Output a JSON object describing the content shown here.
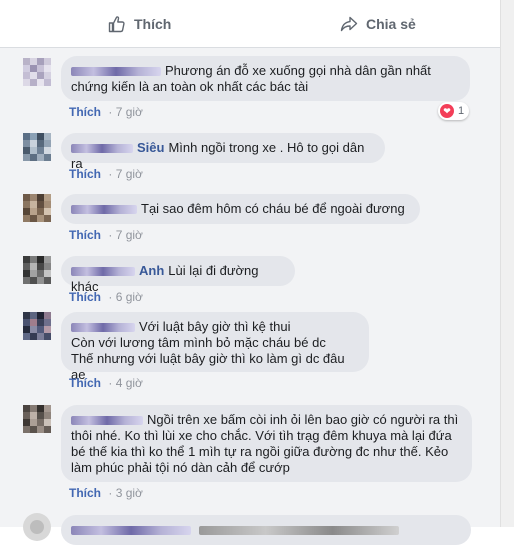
{
  "actions": {
    "like_label": "Thích",
    "share_label": "Chia sẻ"
  },
  "comments": [
    {
      "name": "",
      "text": "Phương án đỗ xe xuống gọi nhà dân gần nhất chứng kiến là an toàn ok nhất các bác tài",
      "like_label": "Thích",
      "time": "7 giờ",
      "reaction_count": "1"
    },
    {
      "name": "Siêu",
      "text": "Mình ngồi trong xe . Hô to gọi dân ra",
      "like_label": "Thích",
      "time": "7 giờ"
    },
    {
      "name": "",
      "text": "Tại sao đêm hôm có cháu bé để ngoài đương",
      "like_label": "Thích",
      "time": "7 giờ"
    },
    {
      "name": "Anh",
      "text": "Lùi lại đi đường khác",
      "like_label": "Thích",
      "time": "6 giờ"
    },
    {
      "name": "",
      "text_lines": [
        "Với luật bây giờ thì kệ thui",
        "Còn với lương tâm mình bỏ mặc cháu bé dc",
        "Thế nhưng với luật bây giờ thì ko làm gì dc đâu ae"
      ],
      "like_label": "Thích",
      "time": "4 giờ"
    },
    {
      "name": "",
      "text_lines": [
        "Ngồi trên xe bấm còi inh ỏi lên bao giờ có người ra thì",
        "thôi nhé. Ko thì lùi xe cho chắc. Với tìh trạg đêm khuya mà lại đứa",
        "bé thế kia thì ko thể 1 mìh tự ra ngồi giữa đường đc như thế. Kẻo",
        "làm phúc phải tội nó dàn cảh để cướp"
      ],
      "like_label": "Thích",
      "time": "3 giờ"
    }
  ]
}
